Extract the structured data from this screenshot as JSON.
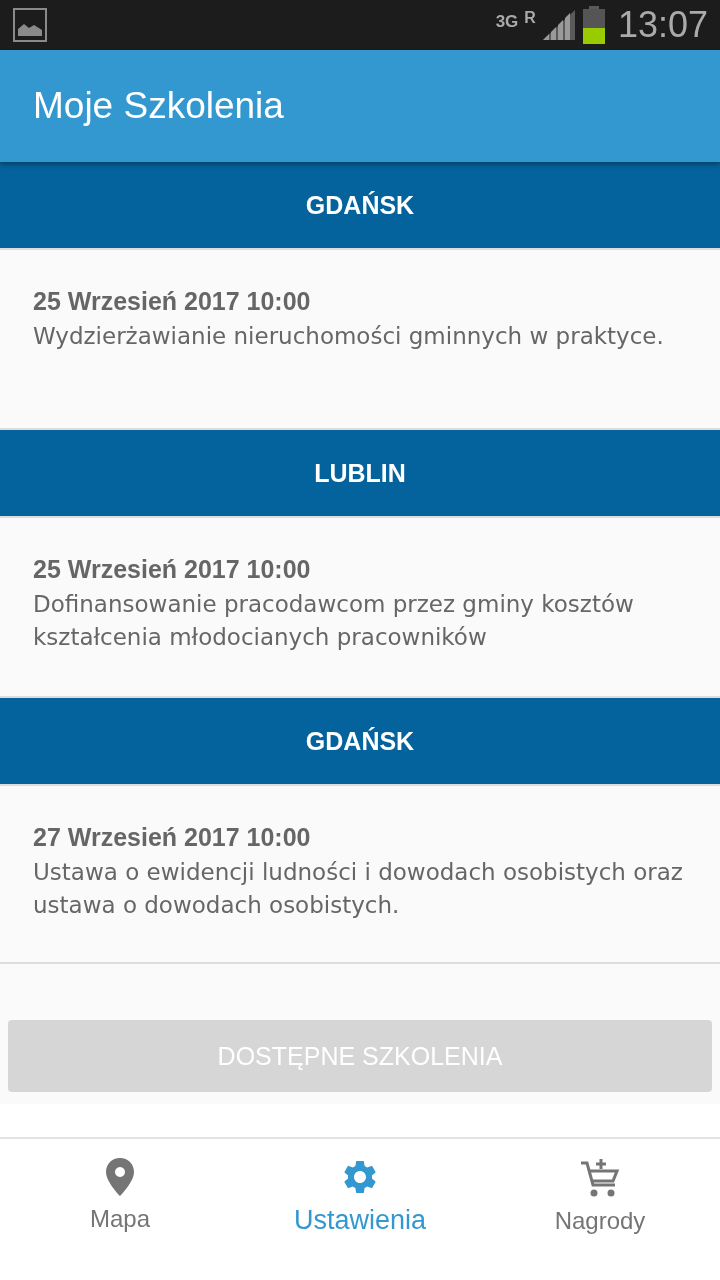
{
  "status_bar": {
    "network": "3G",
    "roaming": "R",
    "time": "13:07"
  },
  "app_bar": {
    "title": "Moje Szkolenia"
  },
  "sections": [
    {
      "city": "GDAŃSK",
      "items": [
        {
          "date": "25 Wrzesień 2017 10:00",
          "title": "Wydzierżawianie nieruchomości gminnych w praktyce."
        }
      ]
    },
    {
      "city": "LUBLIN",
      "items": [
        {
          "date": "25 Wrzesień 2017 10:00",
          "title": "Dofinansowanie pracodawcom przez gminy kosztów kształcenia młodocianych pracowników"
        }
      ]
    },
    {
      "city": "GDAŃSK",
      "items": [
        {
          "date": "27 Wrzesień 2017 10:00",
          "title": "Ustawa o ewidencji ludności i dowodach osobistych oraz ustawa o dowodach osobistych."
        }
      ]
    }
  ],
  "floating_button": {
    "label": "DOSTĘPNE SZKOLENIA",
    "disabled": true
  },
  "bottom_nav": [
    {
      "label": "Mapa",
      "kind": "pin",
      "selected": false
    },
    {
      "label": "Ustawienia",
      "kind": "gear",
      "selected": true
    },
    {
      "label": "Nagrody",
      "kind": "cart",
      "selected": false
    }
  ]
}
